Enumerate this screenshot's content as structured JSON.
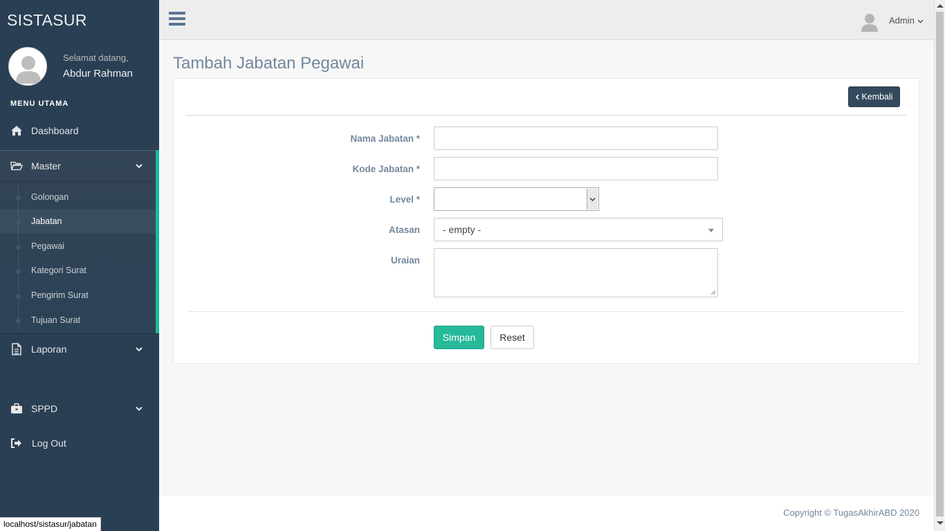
{
  "sidebar": {
    "brand": "SISTASUR",
    "welcome": "Selamat datang,",
    "username": "Abdur Rahman",
    "menu_title": "MENU UTAMA",
    "dashboard": "Dashboard",
    "master": "Master",
    "master_items": [
      "Golongan",
      "Jabatan",
      "Pegawai",
      "Kategori Surat",
      "Pengirim Surat",
      "Tujuan Surat"
    ],
    "active_item": "Jabatan",
    "laporan": "Laporan",
    "sppd": "SPPD",
    "logout": "Log Out"
  },
  "topnav": {
    "user_label": "Admin",
    "menu_icon": "hamburger-icon"
  },
  "page": {
    "title": "Tambah Jabatan Pegawai",
    "back_button": "Kembali"
  },
  "form": {
    "nama_jabatan_label": "Nama Jabatan *",
    "nama_jabatan_value": "",
    "kode_jabatan_label": "Kode Jabatan *",
    "kode_jabatan_value": "",
    "level_label": "Level *",
    "level_value": "",
    "atasan_label": "Atasan",
    "atasan_value": "- empty -",
    "uraian_label": "Uraian",
    "uraian_value": "",
    "submit_label": "Simpan",
    "reset_label": "Reset"
  },
  "footer": {
    "copyright": "Copyright © TugasAkhirABD 2020"
  },
  "status_url": "localhost/sistasur/jabatan",
  "colors": {
    "sidebar_bg": "#2a3f54",
    "accent_green": "#1abb9c",
    "submit_green": "#26b99a",
    "back_button_bg": "#34495e",
    "text_muted": "#73879c"
  }
}
